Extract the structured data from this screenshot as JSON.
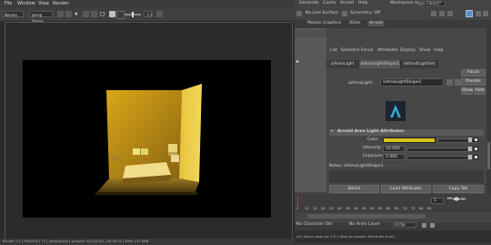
{
  "render_view": {
    "menu": [
      "File",
      "Window",
      "View",
      "Render"
    ],
    "toolbar": {
      "layer": "Beauty",
      "camera": "persp Shape",
      "ratio": "1:1"
    },
    "status": "Render 1:1 | 960x540 | 72 | perspShape | samples 3/2/2/2/2/2 | 00:00:02 | Mem 137.8MB"
  },
  "main": {
    "menubar": {
      "generate": "Generate",
      "cache": "Cache",
      "arnold": "Arnold",
      "help": "Help",
      "workspace_label": "Workspace:",
      "workspace_value": "Maya Classic*"
    },
    "toolbar": {
      "live_surface": "No Live Surface",
      "symmetry": "Symmetry: Off"
    },
    "shelf_tabs": [
      "Motion Graphics",
      "XGen",
      "Arnold"
    ]
  },
  "attribute_editor": {
    "menu": [
      "List",
      "Selected",
      "Focus",
      "Attributes",
      "Display",
      "Show",
      "Help"
    ],
    "tabs": [
      "aiAreaLight",
      "aiAreaLightShape1",
      "defaultLightSet"
    ],
    "node_label": "aiAreaLight:",
    "node_value": "aiAreaLightShape1",
    "focus_btn": "Focus",
    "presets_btn": "Presets",
    "show_btn": "Show",
    "hide_btn": "Hide",
    "section_title": "Arnold Area Light Attributes",
    "color_label": "Color",
    "intensity_label": "Intensity",
    "intensity_value": "10.000",
    "exposure_label": "Exposure",
    "exposure_value": "5.000",
    "notes_label": "Notes: aiAreaLightShape1",
    "select_btn": "Select",
    "load_btn": "Load Attributes",
    "copy_btn": "Copy Tab",
    "light_color": "#d9c21a"
  },
  "timeline": {
    "ticks": [
      "5",
      "10",
      "15",
      "20",
      "25",
      "30",
      "35",
      "40",
      "45",
      "50",
      "55",
      "60",
      "65",
      "70",
      "75",
      "80",
      "85",
      "90",
      "95",
      "100",
      "105",
      "110",
      "115"
    ],
    "current_frame": "1",
    "char_set": "No Character Set",
    "anim_layer": "No Anim Layer",
    "fps": "24 fps"
  },
  "bottom_status": "cd | Scene clean ok: 3.0-1 Start to compile: Scene file is sel..."
}
